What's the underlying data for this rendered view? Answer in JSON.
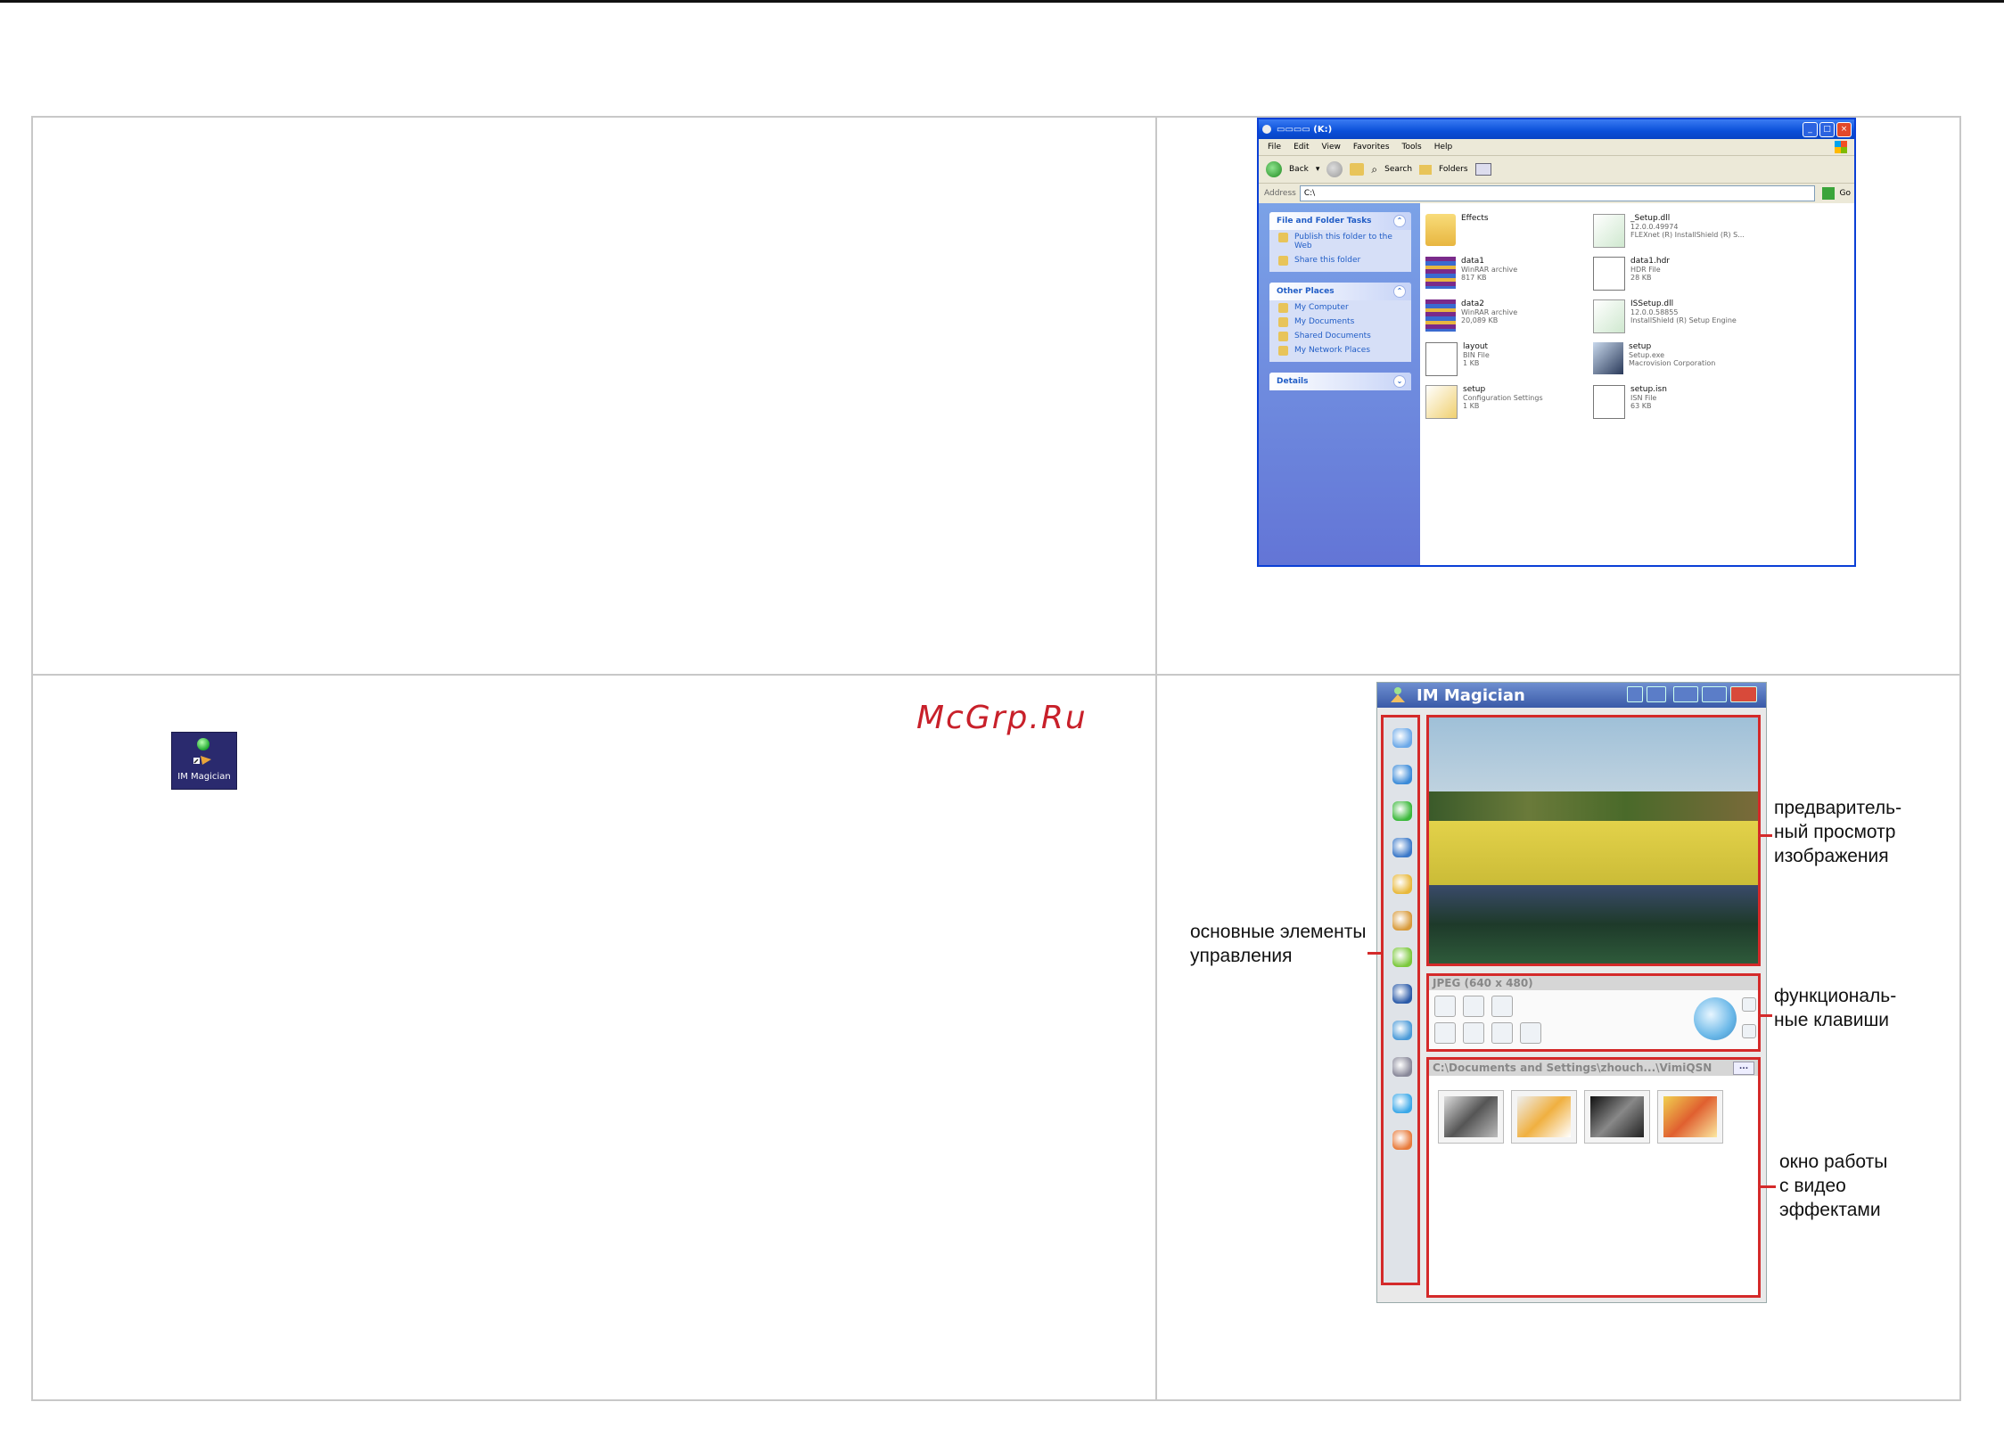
{
  "watermark": "McGrp.Ru",
  "desktop_icon": {
    "label": "IM Magician"
  },
  "explorer": {
    "title": "▭▭▭▭ (K:)",
    "menu": [
      "File",
      "Edit",
      "View",
      "Favorites",
      "Tools",
      "Help"
    ],
    "toolbar": {
      "back": "Back",
      "search": "Search",
      "folders": "Folders"
    },
    "address_label": "Address",
    "address_value": "C:\\",
    "go": "Go",
    "panels": [
      {
        "title": "File and Folder Tasks",
        "links": [
          "Publish this folder to the Web",
          "Share this folder"
        ]
      },
      {
        "title": "Other Places",
        "links": [
          "My Computer",
          "My Documents",
          "Shared Documents",
          "My Network Places"
        ]
      },
      {
        "title": "Details",
        "links": []
      }
    ],
    "files": [
      {
        "name": "Effects",
        "l1": "",
        "l2": "",
        "kind": "folder"
      },
      {
        "name": "_Setup.dll",
        "l1": "12.0.0.49974",
        "l2": "FLEXnet (R) InstallShield (R) S...",
        "kind": "dll"
      },
      {
        "name": "data1",
        "l1": "WinRAR archive",
        "l2": "817 KB",
        "kind": "rar"
      },
      {
        "name": "data1.hdr",
        "l1": "HDR File",
        "l2": "28 KB",
        "kind": "doc"
      },
      {
        "name": "data2",
        "l1": "WinRAR archive",
        "l2": "20,089 KB",
        "kind": "rar"
      },
      {
        "name": "ISSetup.dll",
        "l1": "12.0.0.58855",
        "l2": "InstallShield (R) Setup Engine",
        "kind": "dll"
      },
      {
        "name": "layout",
        "l1": "BIN File",
        "l2": "1 KB",
        "kind": "doc"
      },
      {
        "name": "setup",
        "l1": "Setup.exe",
        "l2": "Macrovision Corporation",
        "kind": "exe"
      },
      {
        "name": "setup",
        "l1": "Configuration Settings",
        "l2": "1 KB",
        "kind": "ini"
      },
      {
        "name": "setup.isn",
        "l1": "ISN File",
        "l2": "63 KB",
        "kind": "doc"
      }
    ]
  },
  "magician": {
    "title": "IM Magician",
    "format": "JPEG (640 x 480)",
    "path": "C:\\Documents and Settings\\zhouch...\\VimiQSN",
    "dots": "..."
  },
  "annotations": {
    "controls": [
      "основные элементы",
      "управления"
    ],
    "preview": [
      "предваритель-",
      "ный просмотр",
      "изображения"
    ],
    "keys": [
      "функциональ-",
      "ные клавиши"
    ],
    "effects": [
      "окно работы",
      "с видео",
      "эффектами"
    ]
  },
  "colors": {
    "accent_red": "#d42a2a",
    "xp_blue": "#0a4fd8",
    "watermark": "#c8202a"
  }
}
